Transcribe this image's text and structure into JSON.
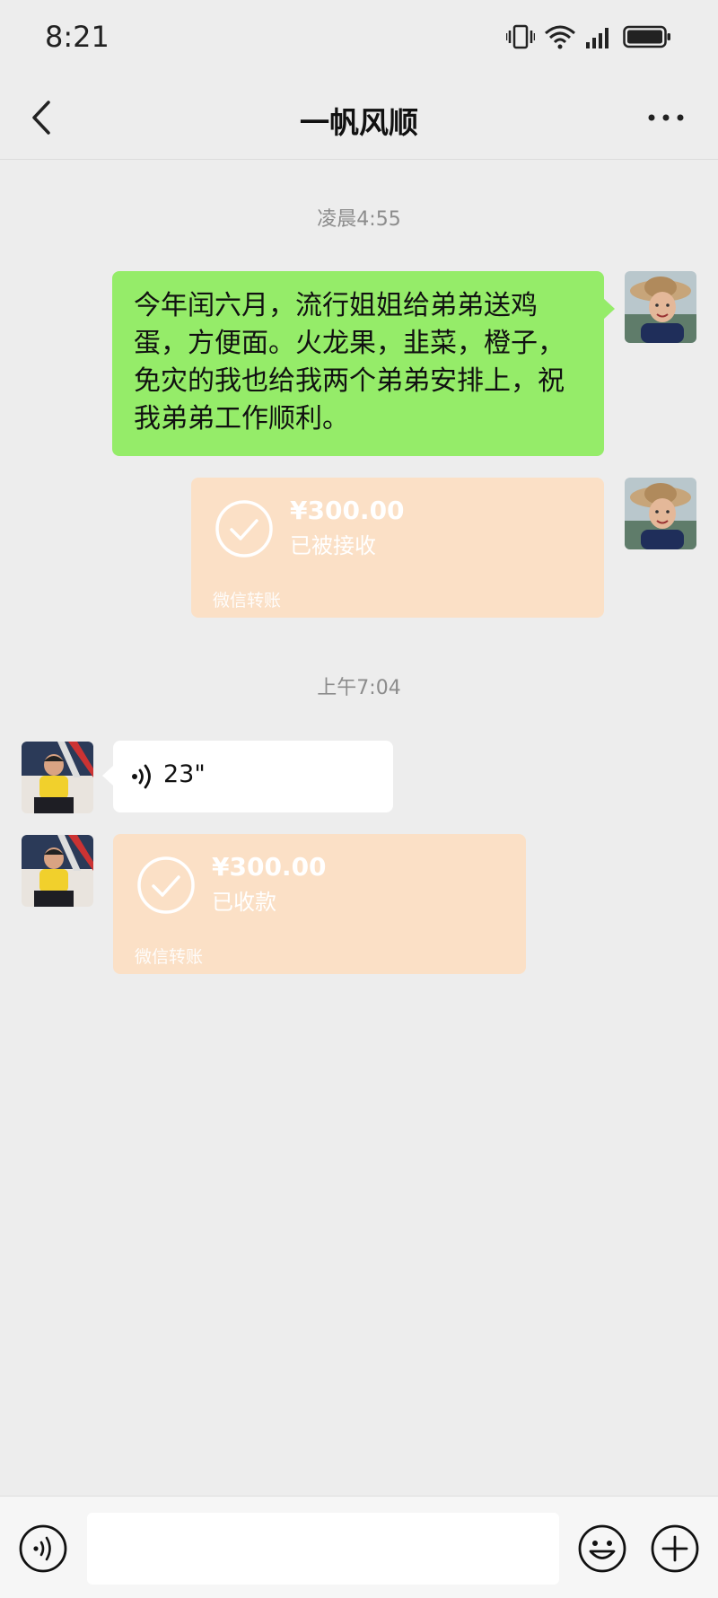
{
  "status_bar": {
    "time": "8:21",
    "icons": [
      "vibrate-icon",
      "wifi-icon",
      "signal-icon",
      "battery-icon"
    ]
  },
  "header": {
    "title": "一帆风顺",
    "back_icon": "chevron-left-icon",
    "more_icon": "more-horizontal-icon"
  },
  "messages": {
    "timestamp_1": "凌晨4:55",
    "outgoing_text": "今年闰六月，流行姐姐给弟弟送鸡蛋，方便面。火龙果，韭菜，橙子，免灾的我也给我两个弟弟安排上，祝我弟弟工作顺利。",
    "outgoing_transfer": {
      "amount": "¥300.00",
      "status": "已被接收",
      "label": "微信转账"
    },
    "timestamp_2": "上午7:04",
    "incoming_voice": {
      "duration": "23\""
    },
    "incoming_transfer": {
      "amount": "¥300.00",
      "status": "已收款",
      "label": "微信转账"
    }
  },
  "input_bar": {
    "voice_icon": "voice-mode-icon",
    "text_value": "",
    "emoji_icon": "emoji-icon",
    "plus_icon": "plus-icon"
  },
  "colors": {
    "background": "#ededed",
    "outgoing_bubble": "#95ec69",
    "transfer_card": "#fbe0c6",
    "incoming_bubble": "#ffffff"
  }
}
